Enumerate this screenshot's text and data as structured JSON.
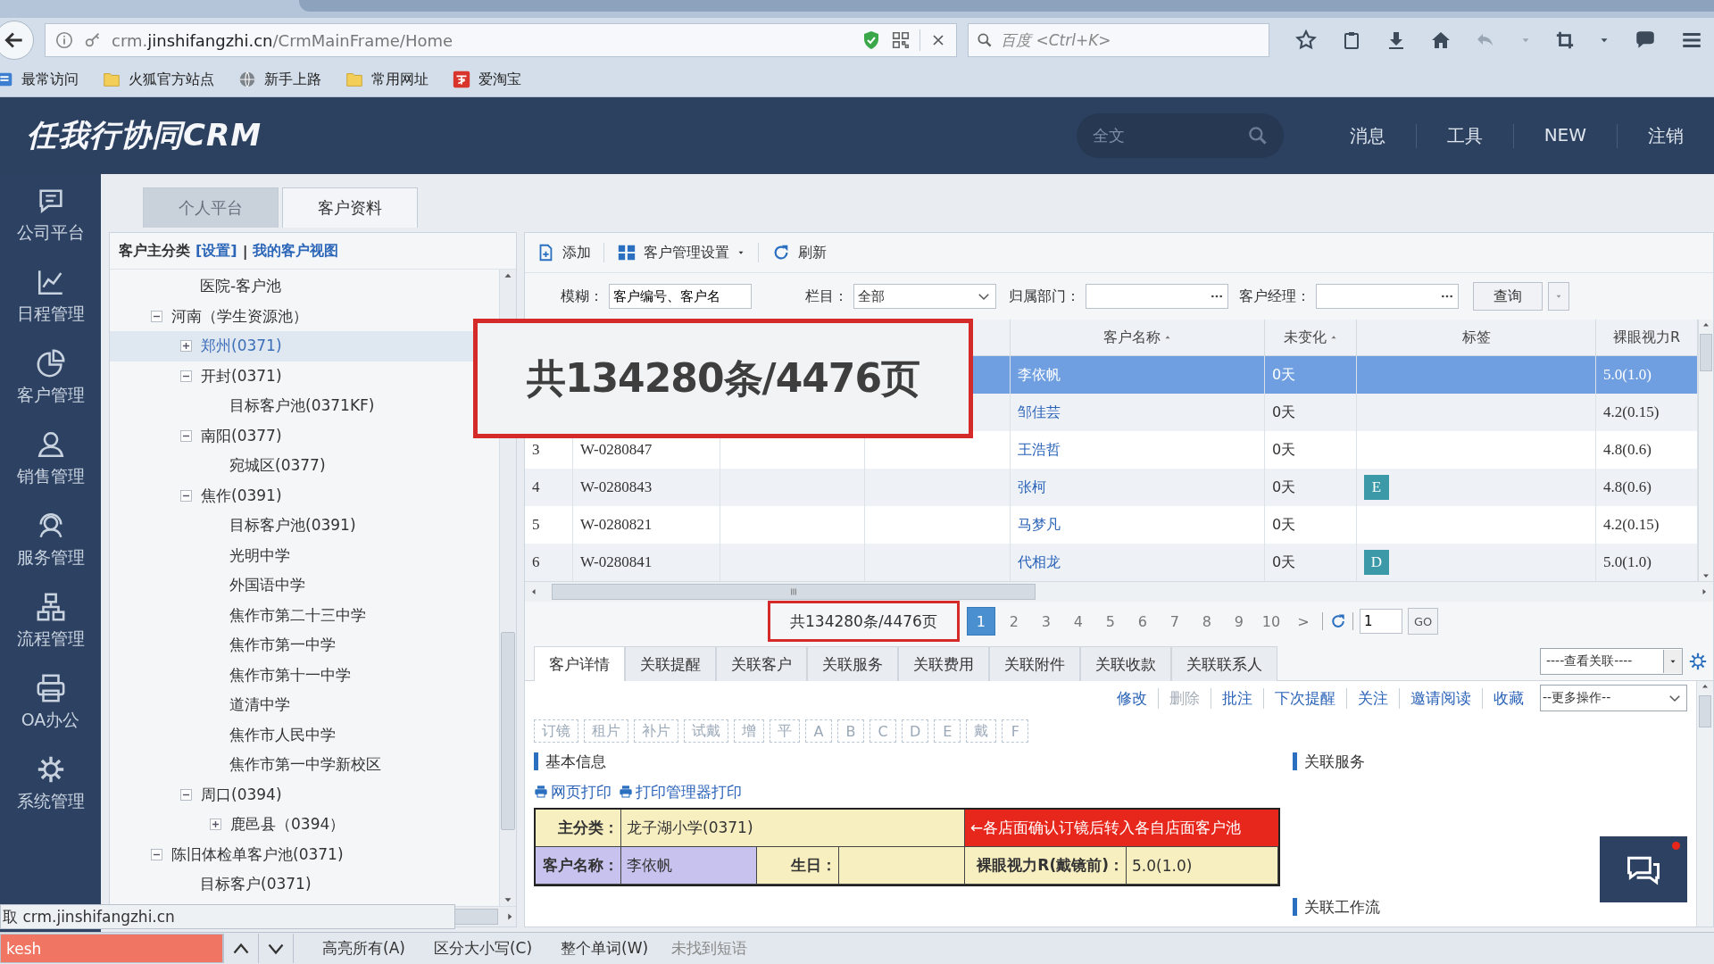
{
  "browser": {
    "url": "crm.**jinshifangzhi.cn**/CrmMainFrame/Home",
    "search_placeholder": "百度 <Ctrl+K>",
    "bookmarks": [
      {
        "label": "最常访问",
        "kind": "list"
      },
      {
        "label": "火狐官方站点",
        "kind": "folder"
      },
      {
        "label": "新手上路",
        "kind": "globe"
      },
      {
        "label": "常用网址",
        "kind": "folder"
      },
      {
        "label": "爱淘宝",
        "kind": "shop"
      }
    ]
  },
  "header": {
    "logo": "任我行协同CRM",
    "search_placeholder": "全文",
    "links": [
      "消息",
      "工具",
      "NEW",
      "注销"
    ]
  },
  "sidebar": {
    "items": [
      {
        "label": "公司平台",
        "kind": "chat"
      },
      {
        "label": "日程管理",
        "kind": "chart"
      },
      {
        "label": "客户管理",
        "kind": "pie"
      },
      {
        "label": "销售管理",
        "kind": "person"
      },
      {
        "label": "服务管理",
        "kind": "headset"
      },
      {
        "label": "流程管理",
        "kind": "org"
      },
      {
        "label": "OA办公",
        "kind": "printer"
      },
      {
        "label": "系统管理",
        "kind": "gear"
      }
    ]
  },
  "tabs": [
    {
      "label": "个人平台",
      "selected": false
    },
    {
      "label": "客户资料",
      "selected": true
    }
  ],
  "tree": {
    "title": "客户主分类",
    "settings_link": "[设置]",
    "separator": "|",
    "view_link": "我的客户视图",
    "nodes": [
      {
        "children": [
          {
            "label": "医院-客户池",
            "selected": false
          }
        ]
      },
      {
        "label": "河南（学生资源池）",
        "expanded": true,
        "selected": false,
        "children": [
          {
            "label": "郑州(0371)",
            "expanded": false,
            "selected": true
          },
          {
            "label": "开封(0371)",
            "expanded": true,
            "selected": false,
            "children": [
              {
                "label": "目标客户池(0371KF)",
                "selected": false
              }
            ]
          },
          {
            "label": "南阳(0377)",
            "expanded": true,
            "selected": false,
            "children": [
              {
                "label": "宛城区(0377)",
                "selected": false
              }
            ]
          },
          {
            "label": "焦作(0391)",
            "expanded": true,
            "selected": false,
            "children": [
              {
                "label": "目标客户池(0391)",
                "selected": false
              },
              {
                "label": "光明中学",
                "selected": false
              },
              {
                "label": "外国语中学",
                "selected": false
              },
              {
                "label": "焦作市第二十三中学",
                "selected": false
              },
              {
                "label": "焦作市第一中学",
                "selected": false
              },
              {
                "label": "焦作市第十一中学",
                "selected": false
              },
              {
                "label": "道清中学",
                "selected": false
              },
              {
                "label": "焦作市人民中学",
                "selected": false
              },
              {
                "label": "焦作市第一中学新校区",
                "selected": false
              }
            ]
          },
          {
            "label": "周口(0394)",
            "expanded": true,
            "selected": false,
            "children": [
              {
                "label": "鹿邑县（0394）",
                "expanded": false,
                "selected": false
              }
            ]
          }
        ]
      },
      {
        "label": "陈旧体检单客户池(0371)",
        "expanded": true,
        "selected": false,
        "children": [
          {
            "label": "目标客户(0371)",
            "selected": false
          }
        ]
      }
    ]
  },
  "toolbar": [
    {
      "label": "添加",
      "kind": "add"
    },
    {
      "label": "客户管理设置",
      "kind": "settings"
    },
    {
      "label": "刷新",
      "kind": "refresh"
    }
  ],
  "filters": {
    "fuzzy_label": "模糊：",
    "fuzzy_value": "客户编号、客户名",
    "column_label": "栏目：",
    "column_value": "全部",
    "dept_label": "归属部门：",
    "manager_label": "客户经理：",
    "query": "查询"
  },
  "table": {
    "columns": [
      {
        "label": "客户名称",
        "sorted": true
      },
      {
        "label": "未变化",
        "sorted": true
      },
      {
        "label": "标签",
        "sorted": false
      },
      {
        "label": "裸眼视力R",
        "sorted": false
      }
    ],
    "rows": [
      {
        "name": "李依帆",
        "days": "0天",
        "vision": "5.0(1.0)",
        "selected": true
      },
      {
        "name": "邹佳芸",
        "days": "0天",
        "vision": "4.2(0.15)",
        "selected": false
      },
      {
        "no": "3",
        "code": "W-0280847",
        "name": "王浩哲",
        "days": "0天",
        "vision": "4.8(0.6)",
        "selected": false
      },
      {
        "no": "4",
        "code": "W-0280843",
        "name": "张柯",
        "days": "0天",
        "tag": "E",
        "vision": "4.8(0.6)",
        "selected": false
      },
      {
        "no": "5",
        "code": "W-0280821",
        "name": "马梦凡",
        "days": "0天",
        "vision": "4.2(0.15)",
        "selected": false
      },
      {
        "no": "6",
        "code": "W-0280841",
        "name": "代相龙",
        "days": "0天",
        "tag": "D",
        "vision": "5.0(1.0)",
        "selected": false
      }
    ]
  },
  "pagination": {
    "summary": "共134280条/4476页",
    "highlighted": true,
    "pages": [
      {
        "label": "1",
        "selected": true
      },
      {
        "label": "2",
        "selected": false
      },
      {
        "label": "3",
        "selected": false
      },
      {
        "label": "4",
        "selected": false
      },
      {
        "label": "5",
        "selected": false
      },
      {
        "label": "6",
        "selected": false
      },
      {
        "label": "7",
        "selected": false
      },
      {
        "label": "8",
        "selected": false
      },
      {
        "label": "9",
        "selected": false
      },
      {
        "label": "10",
        "selected": false
      }
    ],
    "next": ">",
    "page_input": "1",
    "go": "GO"
  },
  "callout": {
    "text": "共134280条/4476页"
  },
  "detail": {
    "tabs": [
      {
        "label": "客户详情",
        "selected": true
      },
      {
        "label": "关联提醒",
        "selected": false
      },
      {
        "label": "关联客户",
        "selected": false
      },
      {
        "label": "关联服务",
        "selected": false
      },
      {
        "label": "关联费用",
        "selected": false
      },
      {
        "label": "关联附件",
        "selected": false
      },
      {
        "label": "关联收款",
        "selected": false
      },
      {
        "label": "关联联系人",
        "selected": false
      }
    ],
    "related_select": "----查看关联----",
    "actions": [
      {
        "label": "修改",
        "disabled": false
      },
      {
        "label": "删除",
        "disabled": true
      },
      {
        "label": "批注",
        "disabled": false
      },
      {
        "label": "下次提醒",
        "disabled": false
      },
      {
        "label": "关注",
        "disabled": false
      },
      {
        "label": "邀请阅读",
        "disabled": false
      },
      {
        "label": "收藏",
        "disabled": false
      }
    ],
    "more_select": "--更多操作--",
    "tag_buttons": [
      "订镜",
      "租片",
      "补片",
      "试戴",
      "增",
      "平",
      "A",
      "B",
      "C",
      "D",
      "E",
      "戴",
      "F"
    ],
    "basic_title": "基本信息",
    "print_links": [
      "网页打印",
      "打印管理器打印"
    ],
    "form": {
      "category_label": "主分类：",
      "category_value": "龙子湖小学(0371)",
      "notice": "←各店面确认订镜后转入各自店面客户池",
      "fields": [
        {
          "label": "客户名称：",
          "value": "李依帆",
          "highlighted": true
        },
        {
          "label": "生日：",
          "highlighted": false
        },
        {
          "label": "裸眼视力R(戴镜前)：",
          "value": "5.0(1.0)",
          "highlighted": false
        }
      ]
    },
    "side_sections": [
      "关联服务",
      "关联工作流"
    ]
  },
  "status_popup": {
    "text": "取 crm.jinshifangzhi.cn"
  },
  "find_bar": {
    "value": "kesh",
    "not_found": true,
    "options": [
      "高亮所有(A)",
      "区分大小写(C)",
      "整个单词(W)"
    ],
    "message": "未找到短语"
  },
  "chat_button": {
    "notification": true
  }
}
